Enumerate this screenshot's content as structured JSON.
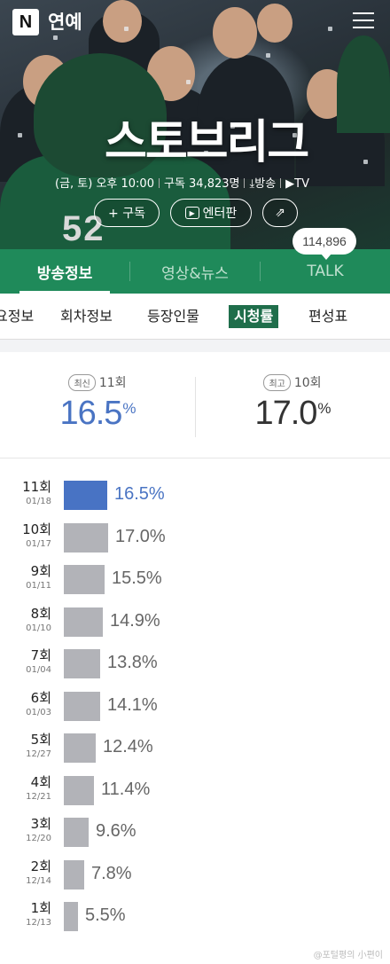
{
  "header": {
    "logo": "N",
    "section_title": "연예"
  },
  "hero": {
    "show_title": "스토브리그",
    "jersey_number": "52",
    "info_schedule": "(금, 토) 오후 10:00",
    "info_subscribers": "구독 34,823명",
    "info_broadcast": "방송",
    "info_tv": "TV",
    "subscribe_button": "+ 구독",
    "enterpan_button": "엔터판"
  },
  "talk_count": "114,896",
  "tabs": [
    {
      "label": "방송정보",
      "active": true
    },
    {
      "label": "영상&뉴스",
      "active": false
    },
    {
      "label": "TALK",
      "active": false
    }
  ],
  "subtabs": [
    {
      "label": "요정보",
      "active": false
    },
    {
      "label": "회차정보",
      "active": false
    },
    {
      "label": "등장인물",
      "active": false
    },
    {
      "label": "시청률",
      "active": true
    },
    {
      "label": "편성표",
      "active": false
    }
  ],
  "summary": {
    "latest": {
      "badge": "최신",
      "episode": "11회",
      "value": "16.5",
      "unit": "%"
    },
    "highest": {
      "badge": "최고",
      "episode": "10회",
      "value": "17.0",
      "unit": "%"
    }
  },
  "colors": {
    "tab_green": "#1f8a5a",
    "highlight_blue": "#4873c4",
    "bar_gray": "#b2b3b8"
  },
  "chart_data": {
    "type": "bar",
    "orientation": "horizontal",
    "unit": "%",
    "categories": [
      "11회",
      "10회",
      "9회",
      "8회",
      "7회",
      "6회",
      "5회",
      "4회",
      "3회",
      "2회",
      "1회"
    ],
    "dates": [
      "01/18",
      "01/17",
      "01/11",
      "01/10",
      "01/04",
      "01/03",
      "12/27",
      "12/21",
      "12/20",
      "12/14",
      "12/13"
    ],
    "values": [
      16.5,
      17.0,
      15.5,
      14.9,
      13.8,
      14.1,
      12.4,
      11.4,
      9.6,
      7.8,
      5.5
    ],
    "labels": [
      "16.5%",
      "17.0%",
      "15.5%",
      "14.9%",
      "13.8%",
      "14.1%",
      "12.4%",
      "11.4%",
      "9.6%",
      "7.8%",
      "5.5%"
    ],
    "highlight_index": 0
  },
  "watermark": "@포털평의 小편이"
}
